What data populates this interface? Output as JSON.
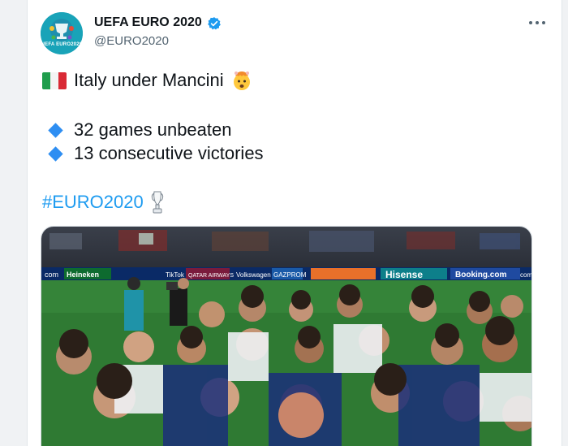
{
  "tweet": {
    "account_name": "UEFA EURO 2020",
    "handle": "@EURO2020",
    "avatar_label": "UEFA EURO2020",
    "headline": "Italy under Mancini",
    "bullets": [
      "32 games unbeaten",
      "13 consecutive victories"
    ],
    "hashtag": "#EURO2020",
    "verified": true
  },
  "photo": {
    "boards": [
      "com",
      "Heineken",
      "TikTok",
      "QATAR AIRWAYS",
      "Volkswagen",
      "GAZPROM",
      "Hisense",
      "Booking.com",
      "com"
    ]
  },
  "colors": {
    "link": "#1d9bf0",
    "verified": "#1d9bf0",
    "bullet": "#2e8ef2",
    "pitch": "#2f7a33",
    "board": "#0a2a66"
  },
  "icons": {
    "flag": "italy-flag-icon",
    "emoji": "exploding-head-icon",
    "trophy": "trophy-icon",
    "bullet": "blue-diamond-icon",
    "verified": "verified-badge-icon",
    "more": "more-options-icon"
  }
}
